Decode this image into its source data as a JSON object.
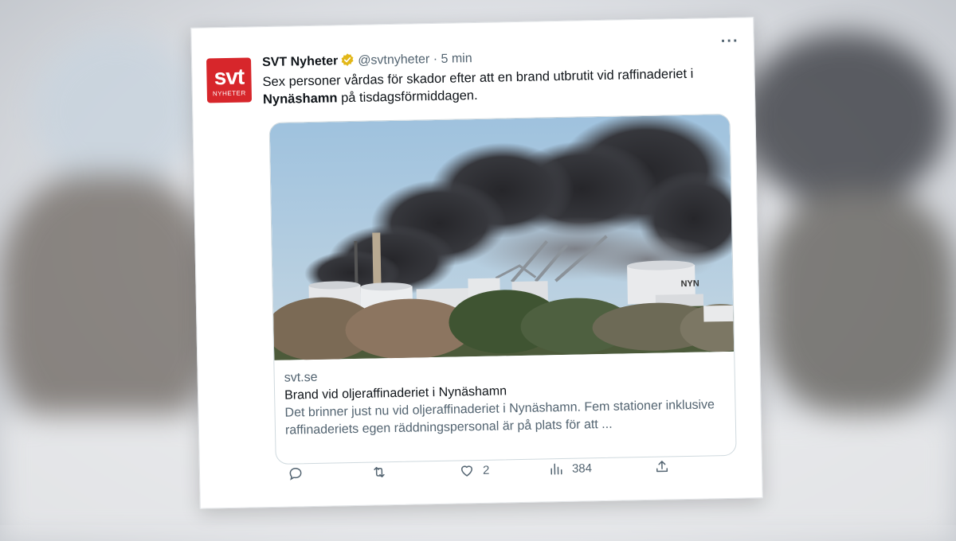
{
  "tweet": {
    "author_name": "SVT Nyheter",
    "handle": "@svtnyheter",
    "separator": "·",
    "time": "5 min",
    "avatar_main": "svt",
    "avatar_sub": "NYHETER",
    "text_part1": "Sex personer vårdas för skador efter att en brand utbrutit vid raffinaderiet i ",
    "text_bold": "Nynäshamn",
    "text_part2": " på tisdagsförmiddagen.",
    "more_icon": "more-horizontal-icon"
  },
  "link_card": {
    "domain": "svt.se",
    "title": "Brand vid oljeraffinaderiet i Nynäshamn",
    "description": "Det brinner just nu vid oljeraffinaderiet i Nynäshamn. Fem stationer inklusive raffinaderiets egen räddningspersonal är på plats för att ...",
    "tank_label": "NYN"
  },
  "actions": {
    "reply_count": "",
    "retweet_count": "",
    "like_count": "2",
    "views_count": "384"
  },
  "colors": {
    "brand_red": "#d7262b",
    "text_primary": "#0f1419",
    "text_secondary": "#536471",
    "verified_gold": "#e2b719"
  }
}
